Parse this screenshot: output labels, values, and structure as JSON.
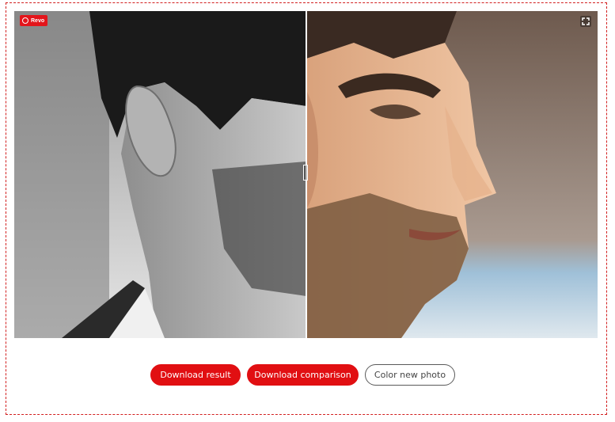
{
  "badge": {
    "label": "Revo",
    "icon": "logo-icon",
    "color": "#e3151b"
  },
  "viewer": {
    "fullscreen_icon": "fullscreen-icon",
    "handle_icon": "slider-handle-icon"
  },
  "actions": {
    "download_result": "Download result",
    "download_comparison": "Download comparison",
    "color_new_photo": "Color new photo"
  },
  "colors": {
    "accent": "#e10f12",
    "frame_border": "#d21f1f"
  }
}
